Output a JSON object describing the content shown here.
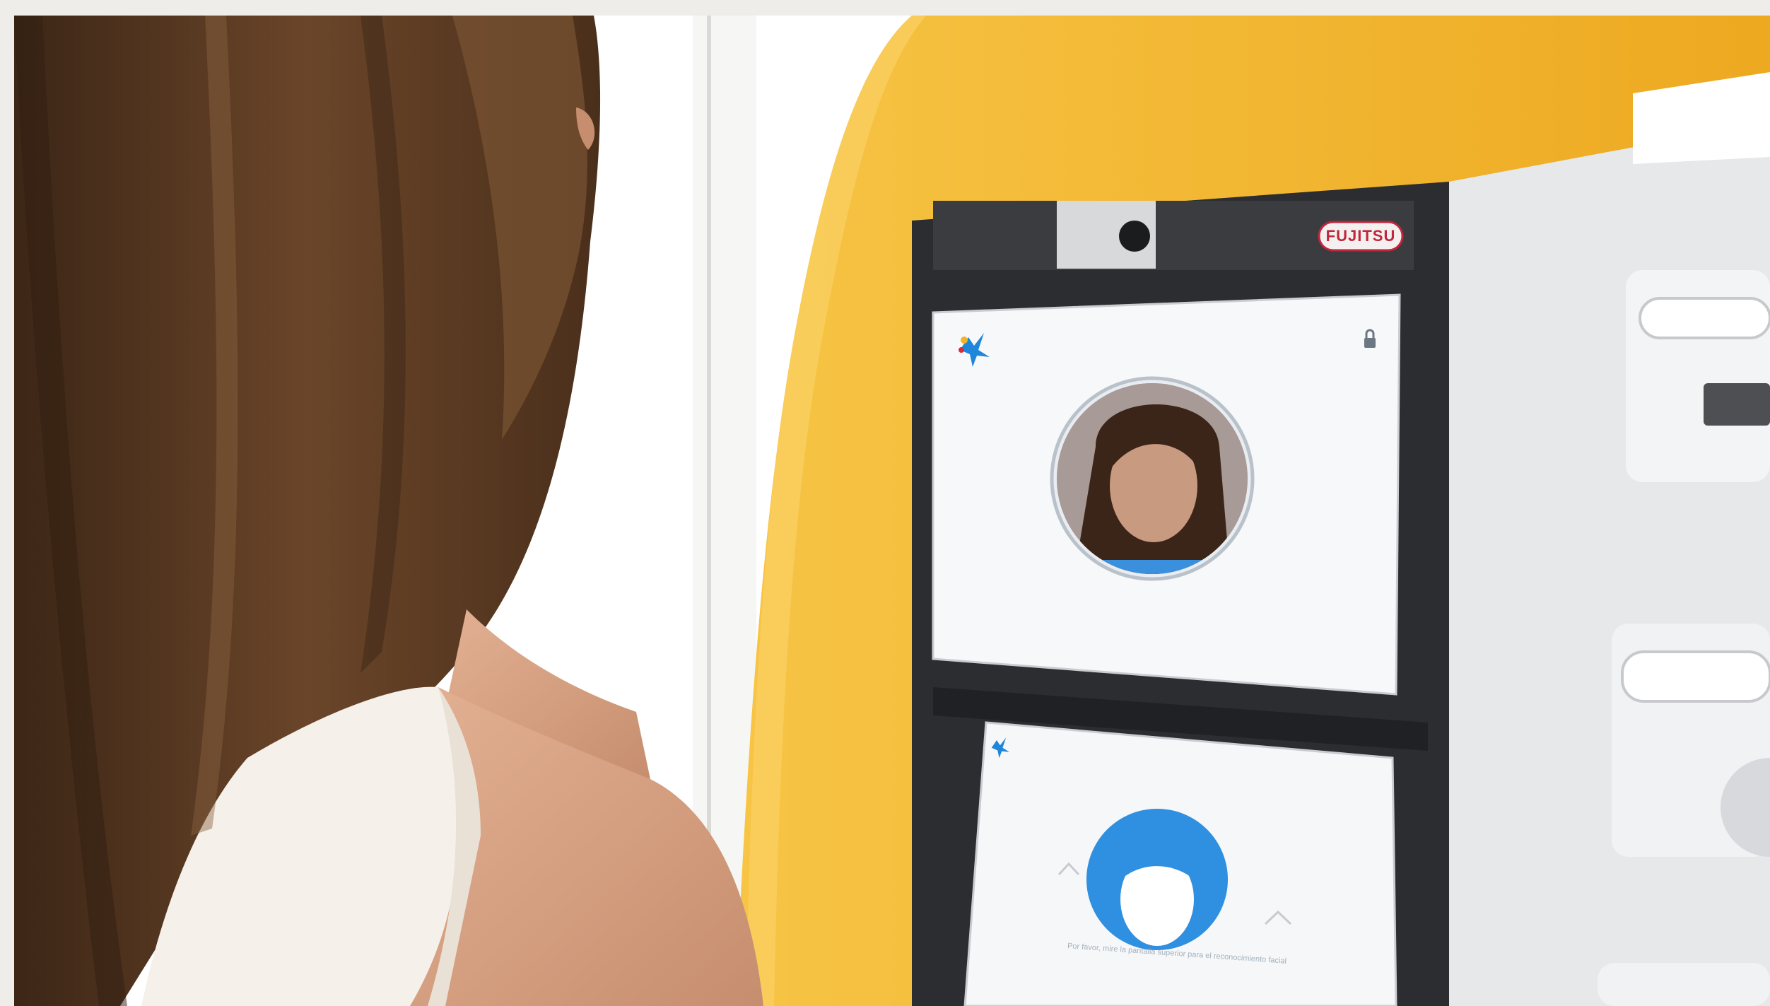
{
  "scene": {
    "description_role": "photo",
    "kiosk_brand": "FUJITSU",
    "lower_screen_instruction": "Por favor, mire la pantalla superior para el reconocimiento facial",
    "colors": {
      "kiosk_yellow": "#f2b328",
      "screen_frame": "#2b2d30",
      "accent_blue": "#2f8fe0",
      "hair": "#5a3b22",
      "skin": "#d7a384",
      "shirt": "#f5f1ea",
      "background_wall": "#ffffff",
      "side_panel": "#eceef0"
    },
    "icons": [
      "caixabank-star-icon",
      "lock-icon",
      "face-avatar-icon",
      "chevron-up-icon",
      "chevron-up-icon"
    ]
  }
}
